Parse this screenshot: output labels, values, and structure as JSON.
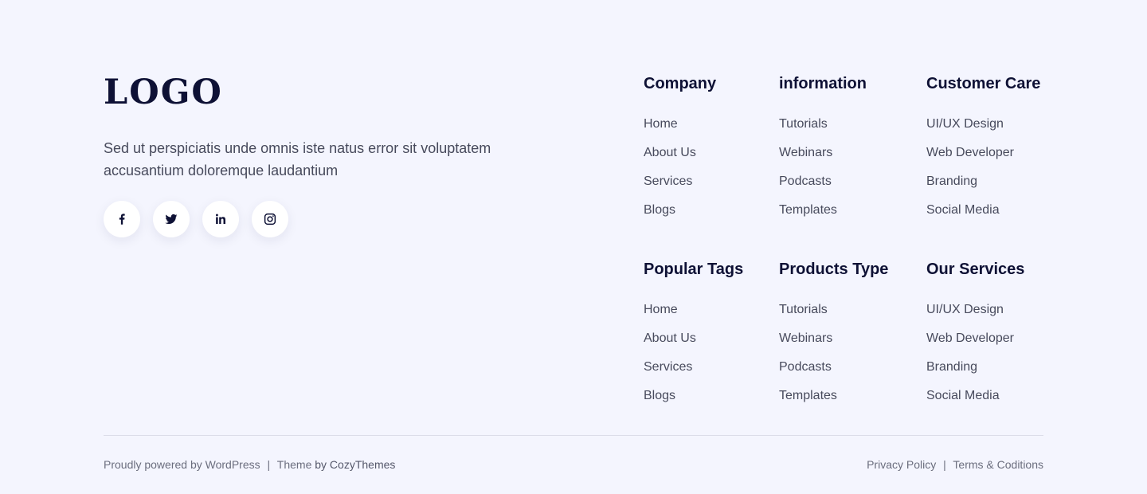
{
  "brand": {
    "logo_text": "LOGO",
    "description": "Sed ut perspiciatis unde omnis iste natus error sit voluptatem accusantium doloremque laudantium"
  },
  "socials": [
    {
      "icon": "facebook-icon"
    },
    {
      "icon": "twitter-icon"
    },
    {
      "icon": "linkedin-icon"
    },
    {
      "icon": "instagram-icon"
    }
  ],
  "columns": [
    {
      "title": "Company",
      "links": [
        "Home",
        "About Us",
        "Services",
        "Blogs"
      ]
    },
    {
      "title": "information",
      "links": [
        "Tutorials",
        "Webinars",
        "Podcasts",
        "Templates"
      ]
    },
    {
      "title": "Customer Care",
      "links": [
        "UI/UX Design",
        "Web Developer",
        "Branding",
        "Social Media"
      ]
    },
    {
      "title": "Popular Tags",
      "links": [
        "Home",
        "About Us",
        "Services",
        "Blogs"
      ]
    },
    {
      "title": "Products Type",
      "links": [
        "Tutorials",
        "Webinars",
        "Podcasts",
        "Templates"
      ]
    },
    {
      "title": "Our Services",
      "links": [
        "UI/UX Design",
        "Web Developer",
        "Branding",
        "Social Media"
      ]
    }
  ],
  "footer": {
    "powered_text": "Proudly powered by WordPress",
    "separator": "|",
    "theme_text": "Theme",
    "by_text": "by CozyThemes",
    "privacy_label": "Privacy Policy",
    "terms_label": "Terms & Coditions"
  },
  "colors": {
    "background": "#f4f5fe",
    "heading": "#0e1135",
    "text": "#474a5c",
    "divider": "#dcdde9"
  }
}
